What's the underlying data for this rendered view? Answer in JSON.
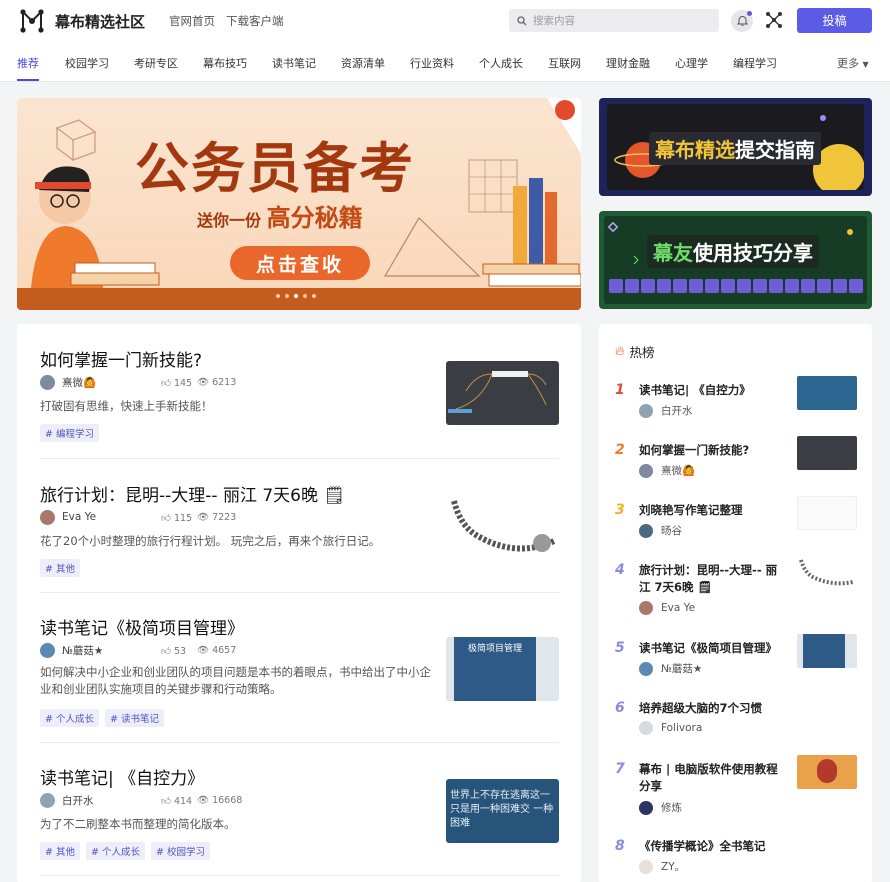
{
  "header": {
    "site_name": "幕布精选社区",
    "links": [
      "官网首页",
      "下载客户端"
    ],
    "search_placeholder": "搜索内容",
    "post_button": "投稿",
    "icons": [
      "logo-icon",
      "search-icon",
      "bell-icon",
      "network-icon"
    ],
    "accent": "#5b5ce6"
  },
  "nav": {
    "items": [
      "推荐",
      "校园学习",
      "考研专区",
      "幕布技巧",
      "读书笔记",
      "资源清单",
      "行业资料",
      "个人成长",
      "互联网",
      "理财金融",
      "心理学",
      "编程学习"
    ],
    "active": "推荐",
    "more": "更多"
  },
  "banner": {
    "title": "公务员备考",
    "sub_prefix": "送你一份",
    "sub_highlight": "高分秘籍",
    "cta": "点击查收",
    "slides": 5,
    "active_slide": 3
  },
  "promos": [
    {
      "highlight": "幕布精选",
      "rest": "提交指南"
    },
    {
      "highlight": "幕友",
      "rest": "使用技巧分享"
    }
  ],
  "posts": [
    {
      "title": "如何掌握一门新技能?",
      "author": "熹微🙆",
      "likes": "145",
      "views": "6213",
      "desc": "打破固有思维，快速上手新技能！",
      "tags": [
        "# 编程学习"
      ]
    },
    {
      "title": "旅行计划：昆明--大理-- 丽江 7天6晚 🗒",
      "author": "Eva Ye",
      "likes": "115",
      "views": "7223",
      "desc": "花了20个小时整理的旅行行程计划。 玩完之后，再来个旅行日记。",
      "tags": [
        "# 其他"
      ]
    },
    {
      "title": "读书笔记《极简项目管理》",
      "author": "№蘑菇★",
      "likes": "53",
      "views": "4657",
      "desc": "如何解决中小企业和创业团队的项目问题是本书的着眼点，书中给出了中小企业和创业团队实施项目的关键步骤和行动策略。",
      "tags": [
        "# 个人成长",
        "# 读书笔记"
      ],
      "thumb_text": "极简项目管理"
    },
    {
      "title": "读书笔记| 《自控力》",
      "author": "白开水",
      "likes": "414",
      "views": "16668",
      "desc": "为了不二刷整本书而整理的简化版本。",
      "tags": [
        "# 其他",
        "# 个人成长",
        "# 校园学习"
      ],
      "thumb_text": "世界上不存在逃离这一 只是用一种困难交 一种困难"
    }
  ],
  "hot": {
    "heading": "热榜",
    "items": [
      {
        "rank": "1",
        "title": "读书笔记| 《自控力》",
        "author": "白开水",
        "color": "#e8473e"
      },
      {
        "rank": "2",
        "title": "如何掌握一门新技能?",
        "author": "熹微🙆",
        "color": "#ee7d2c"
      },
      {
        "rank": "3",
        "title": "刘晓艳写作笔记整理",
        "author": "旸谷",
        "color": "#f0b323"
      },
      {
        "rank": "4",
        "title": "旅行计划：昆明--大理-- 丽江 7天6晚 🗒",
        "author": "Eva Ye",
        "color": "#8a8be0"
      },
      {
        "rank": "5",
        "title": "读书笔记《极简项目管理》",
        "author": "№蘑菇★",
        "color": "#8a8be0"
      },
      {
        "rank": "6",
        "title": "培养超级大脑的7个习惯",
        "author": "Folivora",
        "color": "#8a8be0"
      },
      {
        "rank": "7",
        "title": "幕布 | 电脑版软件使用教程分享",
        "author": "修炼",
        "color": "#8a8be0"
      },
      {
        "rank": "8",
        "title": "《传播学概论》全书笔记",
        "author": "ZY。",
        "color": "#8a8be0"
      }
    ]
  }
}
